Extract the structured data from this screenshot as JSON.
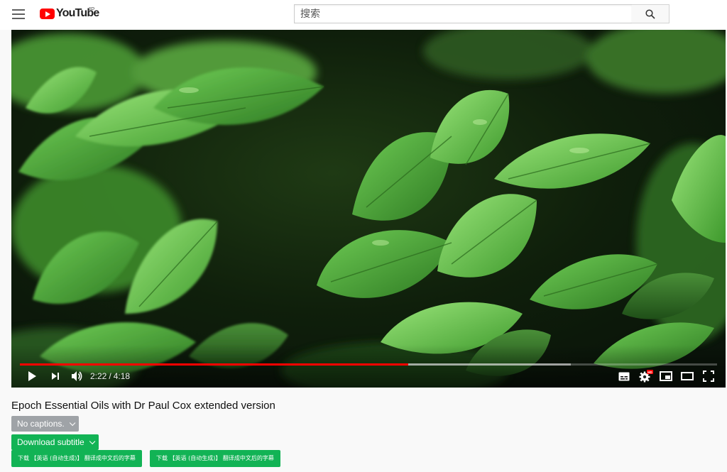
{
  "header": {
    "logo_text": "YouTube",
    "logo_region": "JP",
    "search_placeholder": "搜索"
  },
  "player": {
    "current_time": "2:22",
    "separator": "/",
    "duration": "4:18",
    "played_fraction": 0.557,
    "buffered_fraction": 0.79
  },
  "video": {
    "title": "Epoch Essential Oils with Dr Paul Cox extended version"
  },
  "subtitles": {
    "captions_label": "No captions.",
    "download_label": "Download subtitle",
    "options": [
      "下载 【英语 (自动生成)】 翻译成中文后的字幕",
      "下载 【英语 (自动生成)】 翻译成中文后的字幕"
    ]
  },
  "colors": {
    "brand_red": "#ff0000",
    "download_green": "#12b355",
    "captions_gray": "#9fa3a7"
  }
}
